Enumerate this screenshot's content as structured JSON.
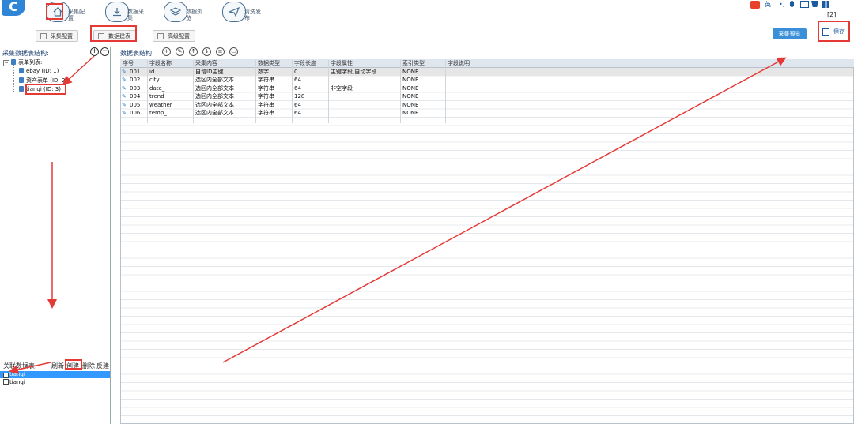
{
  "app": {
    "logo_text": "C"
  },
  "nav": [
    {
      "label": "采集配置",
      "icon": "home-icon"
    },
    {
      "label": "数据采集",
      "icon": "download-icon"
    },
    {
      "label": "数据浏览",
      "icon": "layers-icon"
    },
    {
      "label": "清洗发布",
      "icon": "send-icon"
    }
  ],
  "toolbar": {
    "collect_config": "采集配置",
    "data_table": "数据建表",
    "advanced_config": "高级配置",
    "preview": "采集预览",
    "save": "保存"
  },
  "tray": {
    "lang": "英",
    "badge": "[2]"
  },
  "left": {
    "title": "采集数据表结构:",
    "tree_root": "表单列表:",
    "tree_items": [
      "ebay (ID: 1)",
      "资产表单 (ID: 2)",
      "tianqi (ID: 3)"
    ],
    "relation_title": "关联数据表:",
    "relation_buttons": [
      "刷新",
      "创建",
      "删除",
      "反建"
    ],
    "relation_items": [
      "tianqi",
      "tianqi"
    ]
  },
  "right": {
    "title": "数据表结构",
    "columns": [
      "序号",
      "字段名称",
      "采集内容",
      "数据类型",
      "字段长度",
      "字段属性",
      "索引类型",
      "字段说明"
    ],
    "rows": [
      [
        "001",
        "id",
        "自增ID主键",
        "数字",
        "0",
        "主键字段,自动字段",
        "NONE",
        ""
      ],
      [
        "002",
        "city",
        "选区内全部文本",
        "字符串",
        "64",
        "",
        "NONE",
        ""
      ],
      [
        "003",
        "date_",
        "选区内全部文本",
        "字符串",
        "64",
        "非空字段",
        "NONE",
        ""
      ],
      [
        "004",
        "trend",
        "选区内全部文本",
        "字符串",
        "128",
        "",
        "NONE",
        ""
      ],
      [
        "005",
        "weather",
        "选区内全部文本",
        "字符串",
        "64",
        "",
        "NONE",
        ""
      ],
      [
        "006",
        "temp_",
        "选区内全部文本",
        "字符串",
        "64",
        "",
        "NONE",
        ""
      ]
    ]
  },
  "colors": {
    "accent": "#3a8fd8",
    "annotation": "#e53935",
    "selection": "#3399ff"
  }
}
